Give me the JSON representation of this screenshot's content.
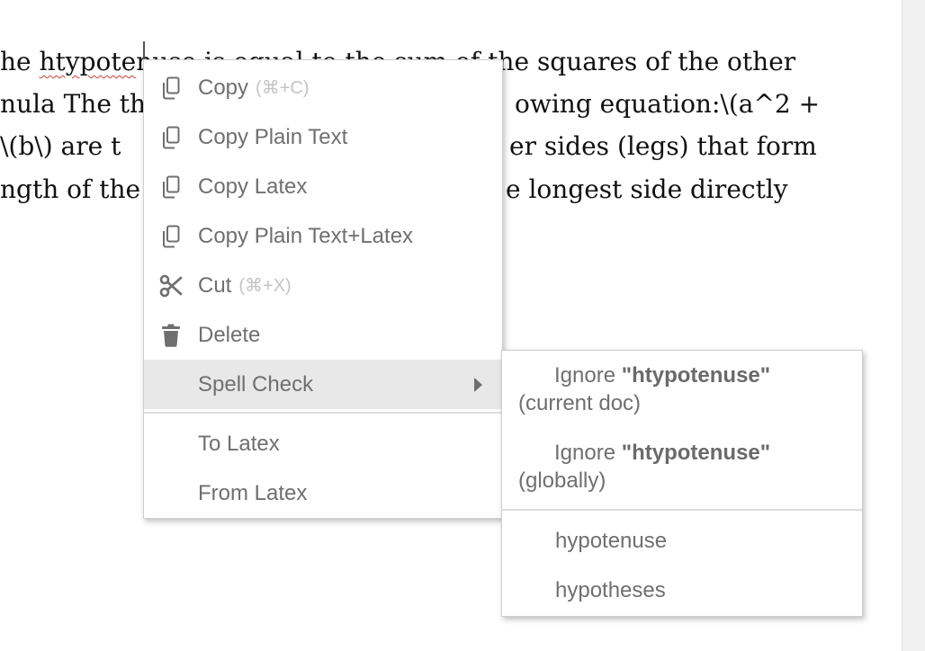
{
  "document": {
    "lines": [
      {
        "before": "he ",
        "misspelled": "htypote",
        "after": "nuse is equal to the sum of the squares of the other"
      },
      {
        "text": "nula The the",
        "after": "owing equation:\\(a^2 +"
      },
      {
        "text": " \\(b\\) are t",
        "after": "er sides (legs) that form"
      },
      {
        "text": "ngth of the",
        "after": "e longest side directly"
      }
    ]
  },
  "context_menu": {
    "copy": {
      "label": "Copy",
      "shortcut": "(⌘+C)",
      "icon": "copy-icon"
    },
    "copy_plain_text": {
      "label": "Copy Plain Text",
      "icon": "copy-icon"
    },
    "copy_latex": {
      "label": "Copy Latex",
      "icon": "copy-icon"
    },
    "copy_plain_text_latex": {
      "label": "Copy Plain Text+Latex",
      "icon": "copy-icon"
    },
    "cut": {
      "label": "Cut",
      "shortcut": "(⌘+X)",
      "icon": "scissors-icon"
    },
    "delete": {
      "label": "Delete",
      "icon": "trash-icon"
    },
    "spell_check": {
      "label": "Spell Check",
      "icon": "chevron-right-icon"
    },
    "to_latex": {
      "label": "To Latex"
    },
    "from_latex": {
      "label": "From Latex"
    }
  },
  "spell_submenu": {
    "ignore_current": {
      "prefix": "Ignore ",
      "word": "\"htypotenuse\"",
      "suffix": "(current doc)"
    },
    "ignore_global": {
      "prefix": "Ignore ",
      "word": "\"htypotenuse\"",
      "suffix": "(globally)"
    },
    "suggestions": [
      "hypotenuse",
      "hypotheses"
    ]
  },
  "colors": {
    "menu_text": "#6f6f6f",
    "hover_bg": "#e8e8e8",
    "spell_underline": "#d13b3b"
  }
}
